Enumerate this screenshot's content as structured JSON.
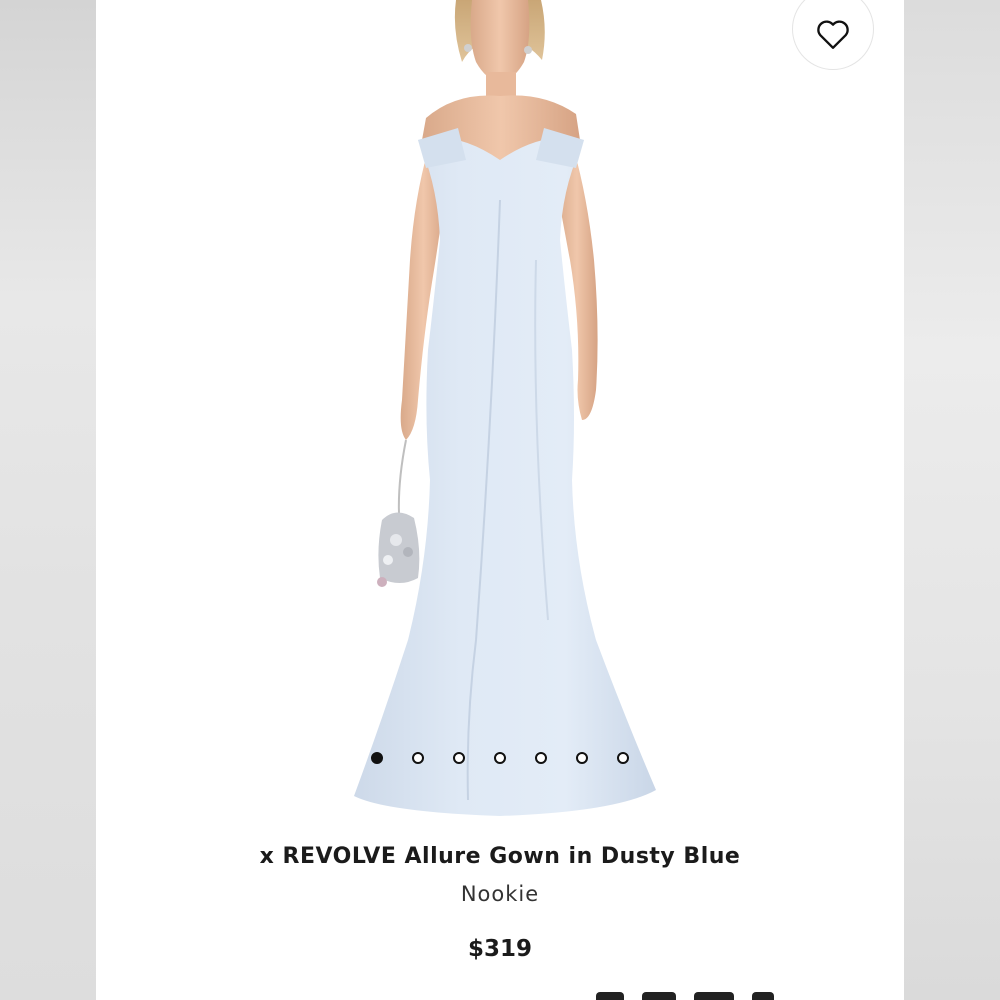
{
  "product": {
    "title": "x REVOLVE Allure Gown in Dusty Blue",
    "brand": "Nookie",
    "price": "$319"
  },
  "gallery": {
    "image_count": 7,
    "active_index": 0
  },
  "icons": {
    "wishlist": "heart-outline-icon"
  },
  "colors": {
    "gown": "#dbe6f3",
    "text": "#1b1b1b",
    "active_dot": "#111111"
  }
}
